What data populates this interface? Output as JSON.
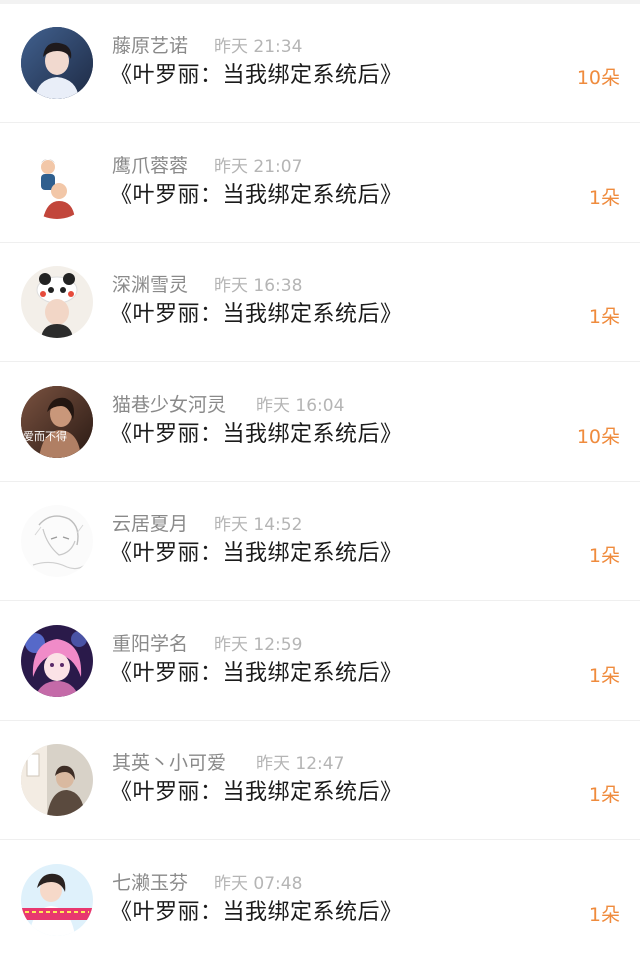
{
  "list": {
    "items": [
      {
        "user": "藤原艺诺",
        "time": "昨天 21:34",
        "book": "《叶罗丽：当我绑定系统后》",
        "count": "10朵",
        "avatar_icon": "avatar-boy-icon",
        "avatar_colors": [
          "#2b3f66",
          "#f1d9cf",
          "#1e2a44"
        ]
      },
      {
        "user": "鹰爪蓉蓉",
        "time": "昨天 21:07",
        "book": "《叶罗丽：当我绑定系统后》",
        "count": "1朵",
        "avatar_icon": "avatar-couple-icon",
        "avatar_colors": [
          "#ffffff",
          "#2f5f8e",
          "#f2c7a8"
        ]
      },
      {
        "user": "深渊雪灵",
        "time": "昨天 16:38",
        "book": "《叶罗丽：当我绑定系统后》",
        "count": "1朵",
        "avatar_icon": "avatar-panda-hat-icon",
        "avatar_colors": [
          "#f3efe9",
          "#222222",
          "#e64b3c"
        ]
      },
      {
        "user": "猫巷少女河灵",
        "time": "昨天 16:04",
        "book": "《叶罗丽：当我绑定系统后》",
        "count": "10朵",
        "avatar_icon": "avatar-girl-dark-icon",
        "avatar_colors": [
          "#4a2f24",
          "#c9977a",
          "#2a1a14"
        ],
        "avatar_caption": "爱而不得"
      },
      {
        "user": "云居夏月",
        "time": "昨天 14:52",
        "book": "《叶罗丽：当我绑定系统后》",
        "count": "1朵",
        "avatar_icon": "avatar-sketch-icon",
        "avatar_colors": [
          "#fbfbfb",
          "#cfcfcf",
          "#9a9a9a"
        ]
      },
      {
        "user": "重阳学名",
        "time": "昨天 12:59",
        "book": "《叶罗丽：当我绑定系统后》",
        "count": "1朵",
        "avatar_icon": "avatar-anime-pink-icon",
        "avatar_colors": [
          "#2a1a4a",
          "#f08bc8",
          "#6a8cff"
        ]
      },
      {
        "user": "其英丶小可爱",
        "time": "昨天 12:47",
        "book": "《叶罗丽：当我绑定系统后》",
        "count": "1朵",
        "avatar_icon": "avatar-room-icon",
        "avatar_colors": [
          "#d8d2c8",
          "#5a4a3e",
          "#f3ece3"
        ]
      },
      {
        "user": "七濑玉芬",
        "time": "昨天 07:48",
        "book": "《叶罗丽：当我绑定系统后》",
        "count": "1朵",
        "avatar_icon": "avatar-banner-girl-icon",
        "avatar_colors": [
          "#dff1fb",
          "#e8386f",
          "#f6d9c9"
        ]
      }
    ]
  },
  "theme": {
    "accent": "#ef8b3d",
    "name_color": "#8a8a8a",
    "time_color": "#b5b5b5",
    "text_color": "#1b1b1b",
    "divider": "#efefef"
  }
}
